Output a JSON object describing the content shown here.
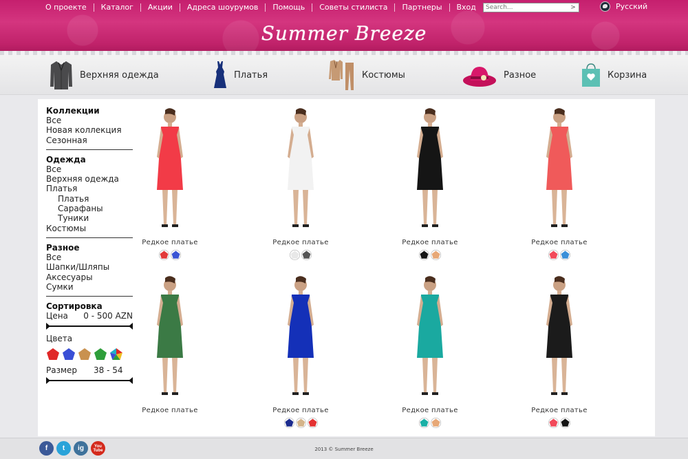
{
  "topnav": [
    "О проекте",
    "Каталог",
    "Акции",
    "Адреса шоурумов",
    "Помощь",
    "Советы стилиста",
    "Партнеры",
    "Вход"
  ],
  "search": {
    "placeholder": "Search...",
    "button": ">"
  },
  "language": "Русский",
  "logo": "Summer Breeze",
  "categories": [
    {
      "label": "Верхняя одежда",
      "icon": "jacket-icon"
    },
    {
      "label": "Платья",
      "icon": "dress-icon"
    },
    {
      "label": "Костюмы",
      "icon": "suit-icon"
    },
    {
      "label": "Разное",
      "icon": "hat-icon"
    },
    {
      "label": "Корзина",
      "icon": "shopping-bag-icon"
    }
  ],
  "sidebar": {
    "collections": {
      "title": "Коллекции",
      "items": [
        "Все",
        "Новая коллекция",
        "Сезонная"
      ]
    },
    "clothes": {
      "title": "Одежда",
      "items": [
        "Все",
        "Верхняя одежда",
        "Платья"
      ],
      "subitems": [
        "Платья",
        "Сарафаны",
        "Туники"
      ],
      "last": "Костюмы"
    },
    "misc": {
      "title": "Разное",
      "items": [
        "Все",
        "Шапки/Шляпы",
        "Аксесуары",
        "Сумки"
      ]
    },
    "sort": {
      "title": "Сортировка",
      "price_label": "Цена",
      "price_range": "0 - 500 AZN",
      "colors_label": "Цвета",
      "colors": [
        "#e02828",
        "#3a4fd6",
        "#c9914f",
        "#2e9e3a",
        "multicolor"
      ],
      "size_label": "Размер",
      "size_range": "38 - 54"
    }
  },
  "products": [
    {
      "name": "Редкое платье",
      "dress": "#f23b47",
      "swatches": [
        "#e23a3a",
        "#3b55d4"
      ]
    },
    {
      "name": "Редкое платье",
      "dress": "#f2f2f2",
      "swatches": [
        "#e8e8e8",
        "#555555"
      ]
    },
    {
      "name": "Редкое платье",
      "dress": "#151515",
      "swatches": [
        "#151515",
        "#e7a877"
      ]
    },
    {
      "name": "Редкое платье",
      "dress": "#f05a5a",
      "swatches": [
        "#f24a5a",
        "#3a8fd8"
      ]
    },
    {
      "name": "Редкое платье",
      "dress": "#3b7a45",
      "swatches": []
    },
    {
      "name": "Редкое платье",
      "dress": "#1430b8",
      "swatches": [
        "#1c2c8e",
        "#d4b48a",
        "#e43232"
      ]
    },
    {
      "name": "Редкое платье",
      "dress": "#1aa9a0",
      "swatches": [
        "#1ab0a6",
        "#e7a877"
      ]
    },
    {
      "name": "Редкое платье",
      "dress": "#1b1b1b",
      "swatches": [
        "#f24a5a",
        "#151515"
      ]
    }
  ],
  "footer": {
    "social": [
      {
        "label": "f",
        "color": "#3b5998",
        "icon": "facebook-icon"
      },
      {
        "label": "t",
        "color": "#2aa3d9",
        "icon": "twitter-icon"
      },
      {
        "label": "ig",
        "color": "#3f729b",
        "icon": "instagram-icon"
      },
      {
        "label": "You Tube",
        "color": "#d42a1c",
        "icon": "youtube-icon"
      }
    ],
    "copyright": "2013 © Summer Breeze"
  }
}
